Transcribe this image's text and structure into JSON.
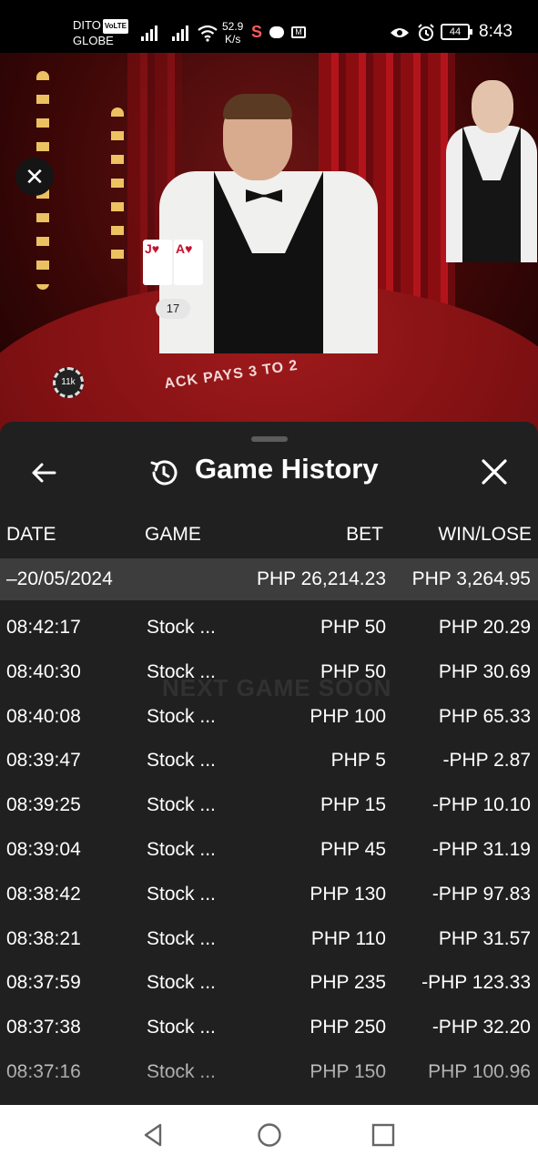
{
  "statusbar": {
    "carrier1": "DITO",
    "volte": "VoLTE",
    "carrier2": "GLOBE",
    "speed_value": "52.9",
    "speed_unit": "K/s",
    "battery": "44",
    "time": "8:43"
  },
  "video": {
    "dealer_cards": [
      {
        "rank": "J",
        "suit": "♥"
      },
      {
        "rank": "A",
        "suit": "♥"
      }
    ],
    "score": "17",
    "table_text": "ACK PAYS 3 TO 2",
    "chip": "11k",
    "ghost_text": "NEXT GAME SOON"
  },
  "sheet": {
    "title": "Game History",
    "columns": {
      "date": "DATE",
      "game": "GAME",
      "bet": "BET",
      "win": "WIN/LOSE"
    },
    "date_row": {
      "date": "–20/05/2024",
      "bet": "PHP 26,214.23",
      "win": "PHP 3,264.95"
    },
    "rows": [
      {
        "time": "08:42:17",
        "game": "Stock ...",
        "bet": "PHP 50",
        "win": "PHP 20.29"
      },
      {
        "time": "08:40:30",
        "game": "Stock ...",
        "bet": "PHP 50",
        "win": "PHP 30.69"
      },
      {
        "time": "08:40:08",
        "game": "Stock ...",
        "bet": "PHP 100",
        "win": "PHP 65.33"
      },
      {
        "time": "08:39:47",
        "game": "Stock ...",
        "bet": "PHP 5",
        "win": "-PHP 2.87"
      },
      {
        "time": "08:39:25",
        "game": "Stock ...",
        "bet": "PHP 15",
        "win": "-PHP 10.10"
      },
      {
        "time": "08:39:04",
        "game": "Stock ...",
        "bet": "PHP 45",
        "win": "-PHP 31.19"
      },
      {
        "time": "08:38:42",
        "game": "Stock ...",
        "bet": "PHP 130",
        "win": "-PHP 97.83"
      },
      {
        "time": "08:38:21",
        "game": "Stock ...",
        "bet": "PHP 110",
        "win": "PHP 31.57"
      },
      {
        "time": "08:37:59",
        "game": "Stock ...",
        "bet": "PHP 235",
        "win": "-PHP 123.33"
      },
      {
        "time": "08:37:38",
        "game": "Stock ...",
        "bet": "PHP 250",
        "win": "-PHP 32.20"
      },
      {
        "time": "08:37:16",
        "game": "Stock ...",
        "bet": "PHP 150",
        "win": "PHP 100.96"
      }
    ]
  },
  "colors": {
    "sheet_bg": "#202020",
    "date_row_bg": "#3d3d3d",
    "text": "#ffffff"
  },
  "icons": {
    "back": "arrow-left-icon",
    "history": "history-icon",
    "close": "close-icon",
    "nav_back": "triangle-back-icon",
    "nav_home": "circle-home-icon",
    "nav_recents": "square-recents-icon"
  }
}
